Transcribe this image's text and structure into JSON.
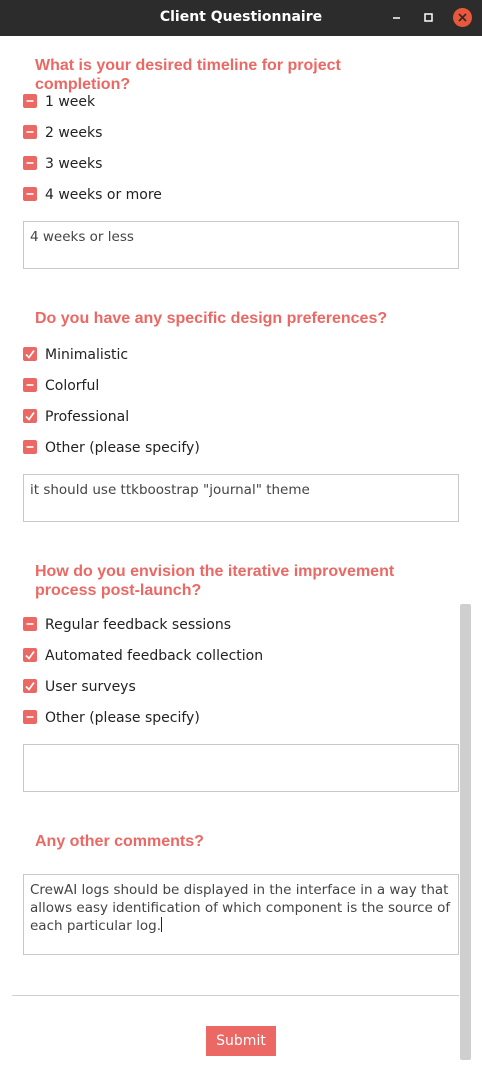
{
  "window": {
    "title": "Client Questionnaire",
    "controls": {
      "minimize_icon": "minimize-icon",
      "maximize_icon": "maximize-icon",
      "close_icon": "close-icon"
    }
  },
  "colors": {
    "accent": "#eb6864",
    "titlebar": "#2c2c2c",
    "close": "#e9583a"
  },
  "questions": [
    {
      "title": "What is your desired timeline for project completion?",
      "options": [
        {
          "label": "1 week",
          "checked": false
        },
        {
          "label": "2 weeks",
          "checked": false
        },
        {
          "label": "3 weeks",
          "checked": false
        },
        {
          "label": "4 weeks or more",
          "checked": false
        }
      ],
      "text_value": "4 weeks or less"
    },
    {
      "title": "Do you have any specific design preferences?",
      "options": [
        {
          "label": "Minimalistic",
          "checked": true
        },
        {
          "label": "Colorful",
          "checked": false
        },
        {
          "label": "Professional",
          "checked": true
        },
        {
          "label": "Other (please specify)",
          "checked": false
        }
      ],
      "text_value": "it should use ttkboostrap \"journal\" theme"
    },
    {
      "title": "How do you envision the iterative improvement process post-launch?",
      "options": [
        {
          "label": "Regular feedback sessions",
          "checked": false
        },
        {
          "label": "Automated feedback collection",
          "checked": true
        },
        {
          "label": "User surveys",
          "checked": true
        },
        {
          "label": "Other (please specify)",
          "checked": false
        }
      ],
      "text_value": ""
    }
  ],
  "comments": {
    "title": "Any other comments?",
    "text_value": "CrewAI logs should be displayed in the interface in a way that allows easy identification of which component is the source of each particular log."
  },
  "submit_label": "Submit"
}
